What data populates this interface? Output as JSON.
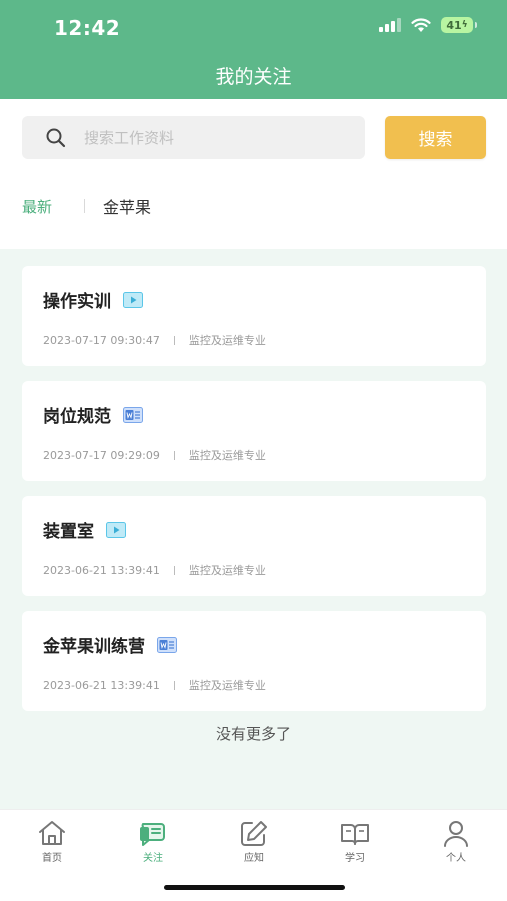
{
  "status_bar": {
    "time": "12:42",
    "battery": "41"
  },
  "nav": {
    "title": "我的关注"
  },
  "search": {
    "placeholder": "搜索工作资料",
    "value": "",
    "button_label": "搜索"
  },
  "filter_tabs": {
    "active": "最新",
    "other": "金苹果"
  },
  "items": [
    {
      "title": "操作实训",
      "file_type": "video",
      "date": "2023-07-17 09:30:47",
      "category": "监控及运维专业"
    },
    {
      "title": "岗位规范",
      "file_type": "word",
      "date": "2023-07-17 09:29:09",
      "category": "监控及运维专业"
    },
    {
      "title": "装置室",
      "file_type": "video",
      "date": "2023-06-21 13:39:41",
      "category": "监控及运维专业"
    },
    {
      "title": "金苹果训练营",
      "file_type": "word",
      "date": "2023-06-21 13:39:41",
      "category": "监控及运维专业"
    }
  ],
  "list_end_text": "没有更多了",
  "tabbar": [
    {
      "label": "首页",
      "icon": "home-icon",
      "active": false
    },
    {
      "label": "关注",
      "icon": "follow-icon",
      "active": true
    },
    {
      "label": "应知",
      "icon": "edit-icon",
      "active": false
    },
    {
      "label": "学习",
      "icon": "book-icon",
      "active": false
    },
    {
      "label": "个人",
      "icon": "person-icon",
      "active": false
    }
  ],
  "colors": {
    "primary_green": "#5db88a",
    "active_green": "#4caf7d",
    "search_button": "#f1bf4f",
    "video_icon": "#5bc6e8",
    "word_icon": "#4a7fd6"
  }
}
